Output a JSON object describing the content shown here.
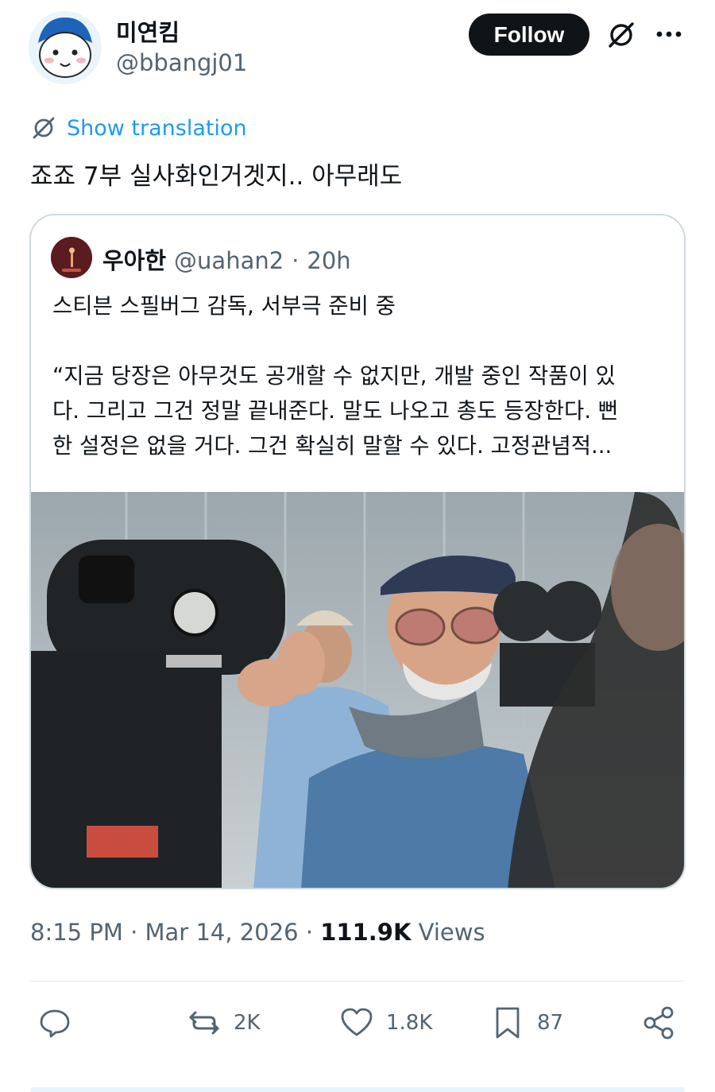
{
  "author": {
    "display_name": "미연킴",
    "handle": "@bbangj01"
  },
  "header": {
    "follow_label": "Follow",
    "translate_icon": "translate-icon",
    "more_icon": "more-dots-icon"
  },
  "translation": {
    "label": "Show translation"
  },
  "tweet": {
    "text": "죠죠 7부 실사화인거겟지.. 아무래도"
  },
  "quote": {
    "name": "우아한",
    "handle": "@uahan2",
    "dot": "·",
    "time": "20h",
    "headline": "스티븐 스필버그 감독, 서부극 준비 중",
    "line1": "“지금 당장은 아무것도 공개할 수 없지만, 개발 중인 작품이 있",
    "line2": "다. 그리고 그건 정말 끝내준다. 말도 나오고 총도 등장한다. 뻔",
    "line3": "한 설정은 없을 거다. 그건 확실히 말할 수 있다. 고정관념적..."
  },
  "meta": {
    "time": "8:15 PM",
    "sep1": "·",
    "date": "Mar 14, 2026",
    "sep2": "·",
    "views_count": "111.9K",
    "views_label": "Views"
  },
  "actions": {
    "reply_count": "",
    "retweet_count": "2K",
    "like_count": "1.8K",
    "bookmark_count": "87"
  },
  "colors": {
    "link_blue": "#1d9bf0",
    "text_primary": "#0f1419",
    "text_secondary": "#536471",
    "border": "#cfd9de"
  }
}
